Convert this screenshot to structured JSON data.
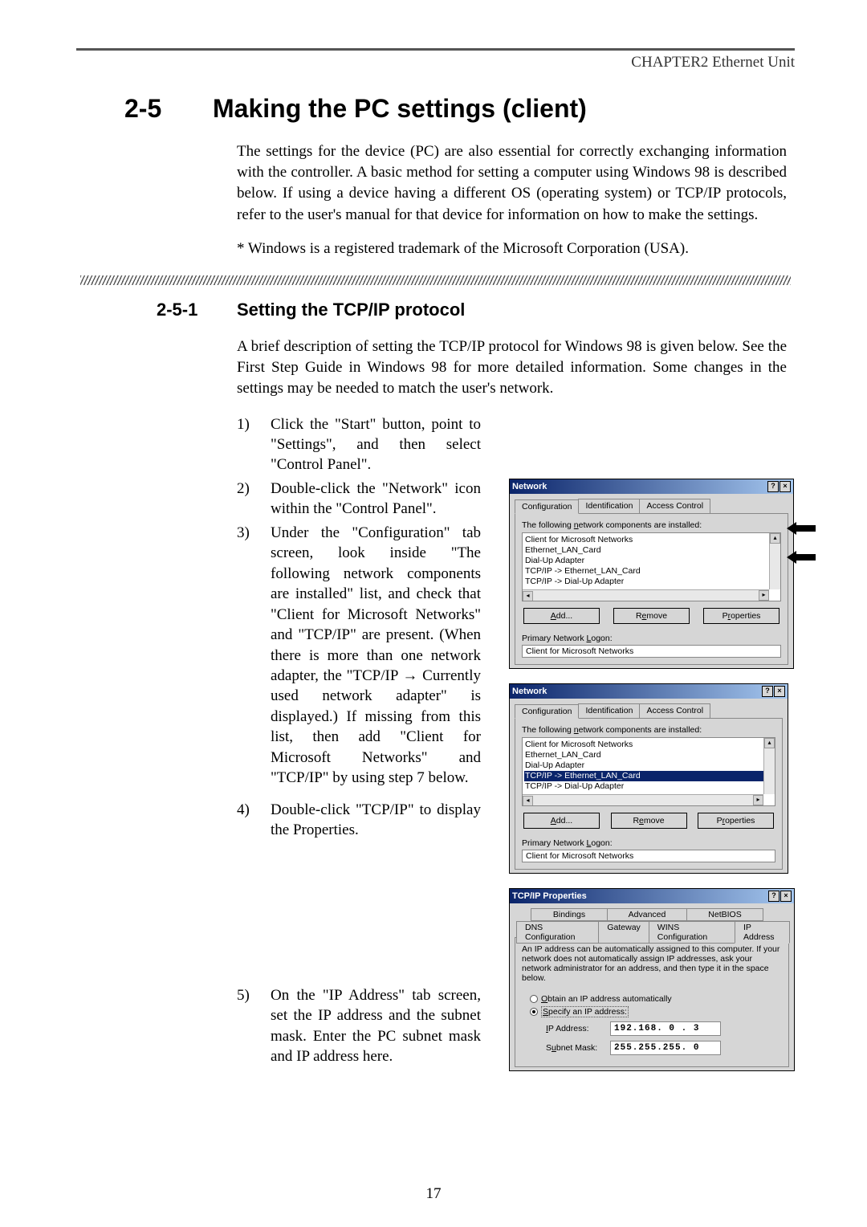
{
  "chapter": "CHAPTER2  Ethernet Unit",
  "section": {
    "num": "2-5",
    "title": "Making the PC settings (client)"
  },
  "intro": "The settings for the device (PC) are also essential for correctly exchanging information with the controller. A basic method for setting a computer using Windows 98 is described below. If using a device having a different OS (operating system) or TCP/IP protocols, refer to the user's manual for that device for information on how to make the settings.",
  "note": "* Windows is a registered trademark of the Microsoft Corporation (USA).",
  "subsection": {
    "num": "2-5-1",
    "title": "Setting the TCP/IP protocol"
  },
  "subintro": "A brief description of setting the TCP/IP protocol for Windows 98 is given below. See the First Step Guide in Windows 98 for more detailed information. Some changes in the settings may be needed to match the user's network.",
  "steps": {
    "s1n": "1)",
    "s1": "Click the \"Start\" button, point to \"Settings\", and then select \"Control Panel\".",
    "s2n": "2)",
    "s2": "Double-click the \"Network\" icon within the \"Control Panel\".",
    "s3n": "3)",
    "s3": "Under the \"Configuration\" tab screen, look inside \"The following network components are installed\" list, and check that \"Client for Microsoft Networks\" and \"TCP/IP\" are present. (When there is more than one network adapter, the \"TCP/IP → Currently used network adapter\" is displayed.) If missing from this list, then add \"Client for Microsoft Networks\" and \"TCP/IP\" by using step 7 below.",
    "s4n": "4)",
    "s4": "Double-click \"TCP/IP\" to display the Properties.",
    "s5n": "5)",
    "s5": "On the \"IP Address\" tab screen, set the IP address and the subnet mask. Enter the PC subnet mask and IP address here."
  },
  "dialog_network": {
    "title": "Network",
    "tab_config": "Configuration",
    "tab_ident": "Identification",
    "tab_access": "Access Control",
    "components_label": "The following network components are installed:",
    "item_client": "Client for Microsoft Networks",
    "item_lancard": "Ethernet_LAN_Card",
    "item_dialup": "Dial-Up Adapter",
    "item_tcpip_lan": "TCP/IP -> Ethernet_LAN_Card",
    "item_tcpip_dial": "TCP/IP -> Dial-Up Adapter",
    "btn_add": "Add...",
    "btn_remove": "Remove",
    "btn_props": "Properties",
    "primary_logon": "Primary Network Logon:",
    "logon_value": "Client for Microsoft Networks"
  },
  "dialog_tcpip": {
    "title": "TCP/IP Properties",
    "tab_bindings": "Bindings",
    "tab_advanced": "Advanced",
    "tab_netbios": "NetBIOS",
    "tab_dns": "DNS Configuration",
    "tab_gateway": "Gateway",
    "tab_wins": "WINS Configuration",
    "tab_ipaddr": "IP Address",
    "explain": "An IP address can be automatically assigned to this computer. If your network does not automatically assign IP addresses, ask your network administrator for an address, and then type it in the space below.",
    "radio_auto": "Obtain an IP address automatically",
    "radio_specify": "Specify an IP address:",
    "ip_label": "IP Address:",
    "ip_value": "192.168. 0 . 3",
    "subnet_label": "Subnet Mask:",
    "subnet_value": "255.255.255. 0"
  },
  "page_num": "17"
}
